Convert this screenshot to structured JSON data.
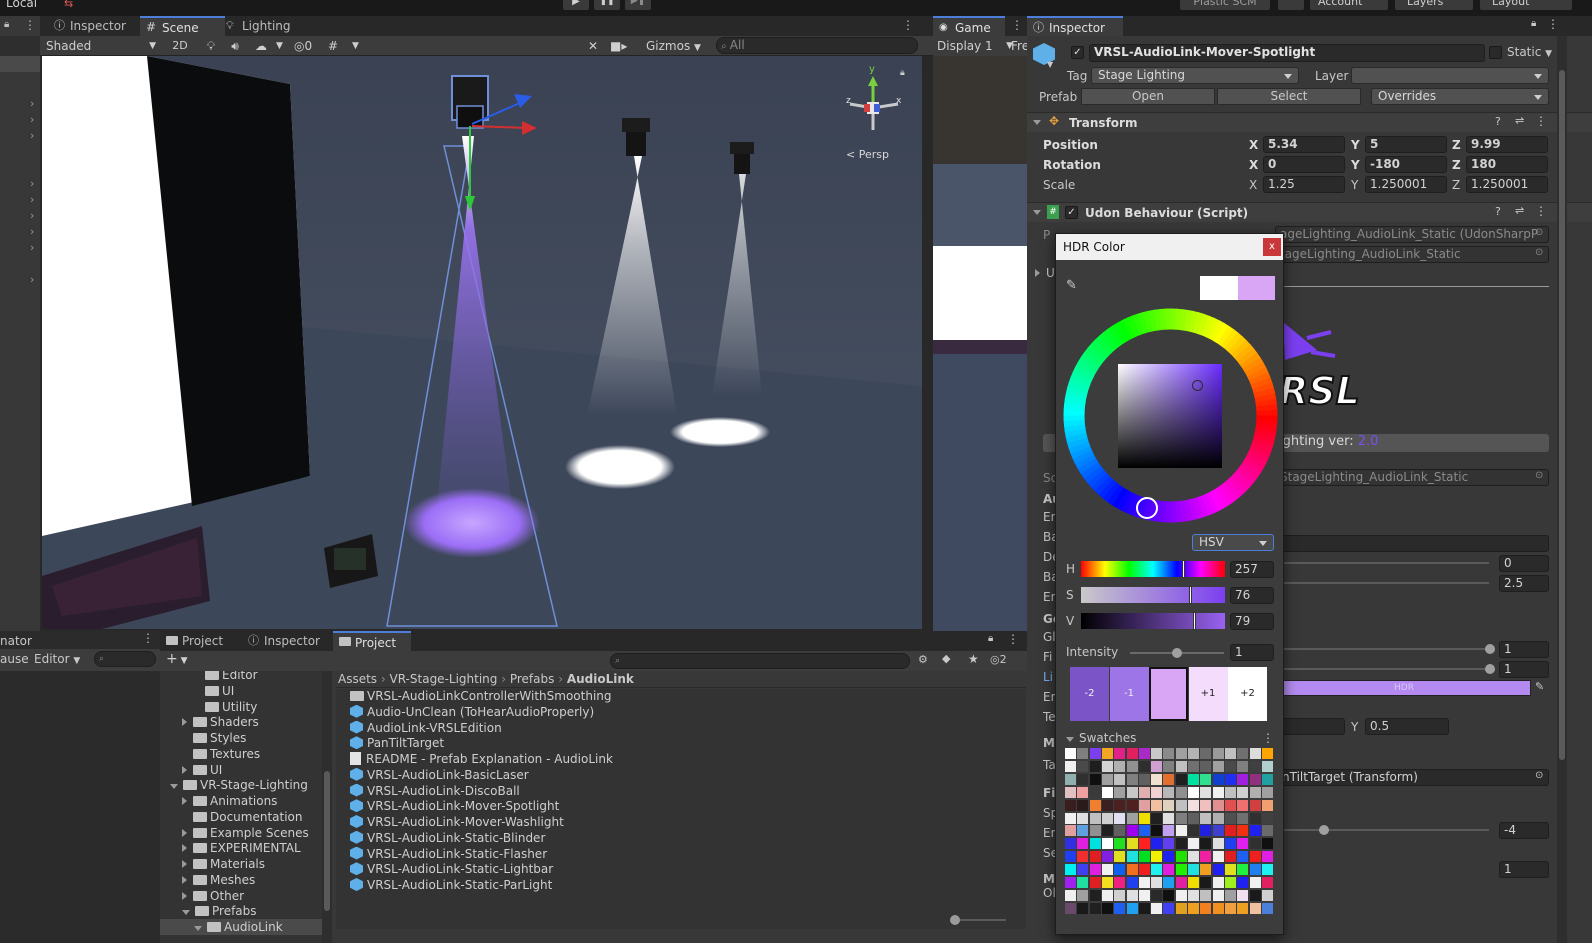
{
  "top_bar": {
    "left_label": "Local",
    "plastic_scm": "Plastic SCM",
    "account": "Account",
    "layers": "Layers",
    "layout": "Layout"
  },
  "scene_window": {
    "tabs": [
      {
        "label": "Inspector",
        "icon": "info-icon"
      },
      {
        "label": "Scene",
        "icon": "grid-icon"
      },
      {
        "label": "Lighting",
        "icon": "bulb-icon"
      }
    ],
    "toolbar": {
      "shading_mode": "Shaded",
      "two_d": "2D",
      "hidden_count": "0",
      "gizmos": "Gizmos",
      "search_placeholder": "All"
    },
    "gizmo": {
      "x": "x",
      "y": "y",
      "z": "z",
      "projection": "Persp"
    }
  },
  "game_window": {
    "tab": "Game",
    "display": "Display 1",
    "aspect": "Fre"
  },
  "animator_panel": {
    "title": "nator",
    "pause": "ause",
    "editor": "Editor"
  },
  "project_window": {
    "tabs": [
      {
        "label": "Project",
        "icon": "folder-icon"
      },
      {
        "label": "Inspector",
        "icon": "info-icon"
      },
      {
        "label": "Project",
        "icon": "folder-icon"
      }
    ],
    "hidden_count": "2",
    "tree": [
      {
        "label": "Editor",
        "indent": 3,
        "arrow": "none"
      },
      {
        "label": "UI",
        "indent": 3,
        "arrow": "none"
      },
      {
        "label": "Utility",
        "indent": 3,
        "arrow": "none"
      },
      {
        "label": "Shaders",
        "indent": 2,
        "arrow": "right"
      },
      {
        "label": "Styles",
        "indent": 2,
        "arrow": "none"
      },
      {
        "label": "Textures",
        "indent": 2,
        "arrow": "none"
      },
      {
        "label": "UI",
        "indent": 2,
        "arrow": "right"
      },
      {
        "label": "VR-Stage-Lighting",
        "indent": 1,
        "arrow": "down"
      },
      {
        "label": "Animations",
        "indent": 2,
        "arrow": "right"
      },
      {
        "label": "Documentation",
        "indent": 2,
        "arrow": "none"
      },
      {
        "label": "Example Scenes",
        "indent": 2,
        "arrow": "right"
      },
      {
        "label": "EXPERIMENTAL",
        "indent": 2,
        "arrow": "right"
      },
      {
        "label": "Materials",
        "indent": 2,
        "arrow": "right"
      },
      {
        "label": "Meshes",
        "indent": 2,
        "arrow": "right"
      },
      {
        "label": "Other",
        "indent": 2,
        "arrow": "right"
      },
      {
        "label": "Prefabs",
        "indent": 2,
        "arrow": "down"
      },
      {
        "label": "AudioLink",
        "indent": 3,
        "arrow": "down"
      }
    ],
    "breadcrumb": [
      "Assets",
      "VR-Stage-Lighting",
      "Prefabs",
      "AudioLink"
    ],
    "files": [
      {
        "label": "VRSL-AudioLinkControllerWithSmoothing",
        "icon": "folder"
      },
      {
        "label": "Audio-UnClean (ToHearAudioProperly)",
        "icon": "prefab"
      },
      {
        "label": "AudioLink-VRSLEdition",
        "icon": "prefab"
      },
      {
        "label": "PanTiltTarget",
        "icon": "prefab"
      },
      {
        "label": "README - Prefab Explanation - AudioLink",
        "icon": "doc"
      },
      {
        "label": "VRSL-AudioLink-BasicLaser",
        "icon": "prefab"
      },
      {
        "label": "VRSL-AudioLink-DiscoBall",
        "icon": "prefab"
      },
      {
        "label": "VRSL-AudioLink-Mover-Spotlight",
        "icon": "prefab"
      },
      {
        "label": "VRSL-AudioLink-Mover-Washlight",
        "icon": "prefab"
      },
      {
        "label": "VRSL-AudioLink-Static-Blinder",
        "icon": "prefab"
      },
      {
        "label": "VRSL-AudioLink-Static-Flasher",
        "icon": "prefab"
      },
      {
        "label": "VRSL-AudioLink-Static-Lightbar",
        "icon": "prefab"
      },
      {
        "label": "VRSL-AudioLink-Static-ParLight",
        "icon": "prefab"
      }
    ]
  },
  "inspector": {
    "tab": "Inspector",
    "object_name": "VRSL-AudioLink-Mover-Spotlight",
    "static_label": "Static",
    "tag_label": "Tag",
    "tag_value": "Stage Lighting",
    "layer_label": "Layer",
    "layer_value": "",
    "prefab_label": "Prefab",
    "prefab_open": "Open",
    "prefab_select": "Select",
    "prefab_overrides": "Overrides",
    "transform": {
      "title": "Transform",
      "position_label": "Position",
      "rotation_label": "Rotation",
      "scale_label": "Scale",
      "position": {
        "x": "5.34",
        "y": "5",
        "z": "9.99"
      },
      "rotation": {
        "x": "0",
        "y": "-180",
        "z": "180"
      },
      "scale": {
        "x": "1.25",
        "y": "1.250001",
        "z": "1.250001"
      }
    },
    "udon": {
      "title": "Udon Behaviour (Script)",
      "row1_label": "P",
      "row1_value": "ageLighting_AudioLink_Static (UdonSharpP",
      "row2_value": "tageLighting_AudioLink_Static",
      "foldout_label": "U",
      "version_label": "ighting ver:",
      "version_value": "2.0",
      "script_label": "Sc",
      "script_value": "StageLighting_AudioLink_Static",
      "section_labels": [
        "Au",
        "En",
        "Ba",
        "De",
        "Ba",
        "En",
        "Ge",
        "Gl",
        "Fi",
        "Li",
        "En",
        "Te",
        "M",
        "Ta",
        "Fi",
        "Sp",
        "En",
        "Se",
        "M",
        "Ol"
      ],
      "values": {
        "delay": "0",
        "band_mult": "2.5",
        "global_intensity": "1",
        "final_intensity": "1",
        "target_y_label": "Y",
        "target_y": "0.5",
        "target_transform": "nTiltTarget (Transform)",
        "spin_speed": "-4",
        "selection": "1",
        "hdr": "HDR"
      }
    }
  },
  "hdr_picker": {
    "title": "HDR Color",
    "close": "x",
    "mode": "HSV",
    "sliders": [
      {
        "label": "H",
        "value": "257"
      },
      {
        "label": "S",
        "value": "76"
      },
      {
        "label": "V",
        "value": "79"
      }
    ],
    "intensity_label": "Intensity",
    "intensity_value": "1",
    "stops": [
      "-2",
      "-1",
      "",
      "+1",
      "+2"
    ],
    "swatches_label": "Swatches",
    "colors": {
      "current": "#d8a6f5",
      "previous": "#ffffff",
      "accent": "#7b3ff0"
    }
  }
}
